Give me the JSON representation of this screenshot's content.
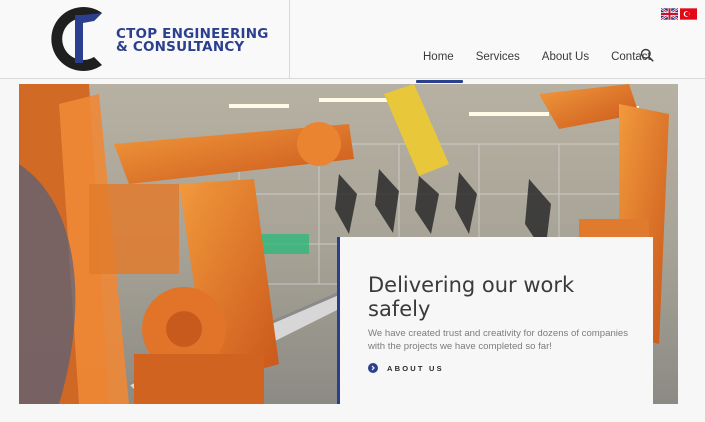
{
  "brand": {
    "line1": "CTOP ENGINEERING",
    "line2": "& CONSULTANCY",
    "color": "#2b3f8f"
  },
  "nav": {
    "items": [
      {
        "label": "Home",
        "active": true
      },
      {
        "label": "Services",
        "active": false
      },
      {
        "label": "About Us",
        "active": false
      },
      {
        "label": "Contact",
        "active": false
      }
    ],
    "search_icon": "search-icon"
  },
  "languages": [
    {
      "icon": "uk-flag-icon"
    },
    {
      "icon": "turkey-flag-icon"
    }
  ],
  "hero": {
    "image_icon": "industrial-robot-arms-image",
    "title": "Delivering our work safely",
    "text": "We have created trust and creativity for dozens of companies with the projects we have completed so far!",
    "link_label": "ABOUT US",
    "link_icon": "chevron-right-icon"
  }
}
